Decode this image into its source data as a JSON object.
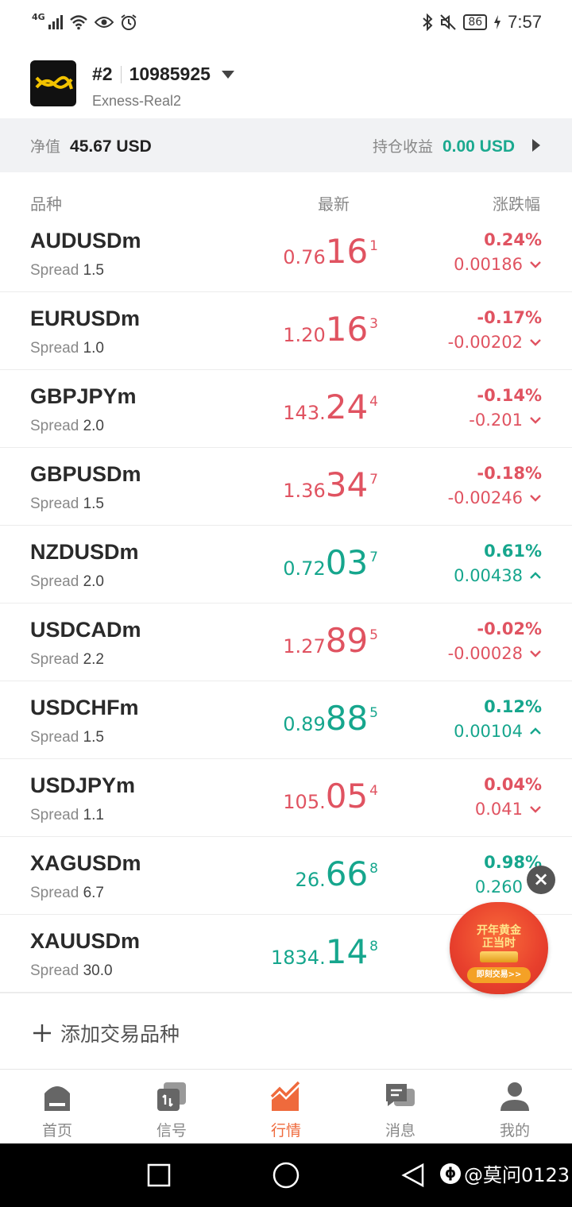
{
  "status_bar": {
    "network": "4G",
    "battery": "86",
    "time": "7:57"
  },
  "account": {
    "number_prefix": "#2",
    "account_id": "10985925",
    "server": "Exness-Real2"
  },
  "summary": {
    "equity_label": "净值",
    "equity_value": "45.67 USD",
    "pl_label": "持仓收益",
    "pl_value": "0.00 USD"
  },
  "columns": {
    "symbol": "品种",
    "latest": "最新",
    "change": "涨跌幅"
  },
  "quotes": [
    {
      "symbol": "AUDUSDm",
      "spread_label": "Spread",
      "spread": "1.5",
      "price_a": "0.76",
      "price_b": "16",
      "price_c": "1",
      "pct": "0.24%",
      "abs": "0.00186",
      "dir": "down",
      "color": "#e05361"
    },
    {
      "symbol": "EURUSDm",
      "spread_label": "Spread",
      "spread": "1.0",
      "price_a": "1.20",
      "price_b": "16",
      "price_c": "3",
      "pct": "-0.17%",
      "abs": "-0.00202",
      "dir": "down",
      "color": "#e05361"
    },
    {
      "symbol": "GBPJPYm",
      "spread_label": "Spread",
      "spread": "2.0",
      "price_a": "143.",
      "price_b": "24",
      "price_c": "4",
      "pct": "-0.14%",
      "abs": "-0.201",
      "dir": "down",
      "color": "#e05361"
    },
    {
      "symbol": "GBPUSDm",
      "spread_label": "Spread",
      "spread": "1.5",
      "price_a": "1.36",
      "price_b": "34",
      "price_c": "7",
      "pct": "-0.18%",
      "abs": "-0.00246",
      "dir": "down",
      "color": "#e05361"
    },
    {
      "symbol": "NZDUSDm",
      "spread_label": "Spread",
      "spread": "2.0",
      "price_a": "0.72",
      "price_b": "03",
      "price_c": "7",
      "pct": "0.61%",
      "abs": "0.00438",
      "dir": "up",
      "color": "#16a68d"
    },
    {
      "symbol": "USDCADm",
      "spread_label": "Spread",
      "spread": "2.2",
      "price_a": "1.27",
      "price_b": "89",
      "price_c": "5",
      "pct": "-0.02%",
      "abs": "-0.00028",
      "dir": "down",
      "color": "#e05361"
    },
    {
      "symbol": "USDCHFm",
      "spread_label": "Spread",
      "spread": "1.5",
      "price_a": "0.89",
      "price_b": "88",
      "price_c": "5",
      "pct": "0.12%",
      "abs": "0.00104",
      "dir": "up",
      "color": "#16a68d"
    },
    {
      "symbol": "USDJPYm",
      "spread_label": "Spread",
      "spread": "1.1",
      "price_a": "105.",
      "price_b": "05",
      "price_c": "4",
      "pct": "0.04%",
      "abs": "0.041",
      "dir": "down",
      "color": "#e05361"
    },
    {
      "symbol": "XAGUSDm",
      "spread_label": "Spread",
      "spread": "6.7",
      "price_a": "26.",
      "price_b": "66",
      "price_c": "8",
      "pct": "0.98%",
      "abs": "0.260",
      "dir": "up",
      "color": "#16a68d"
    },
    {
      "symbol": "XAUUSDm",
      "spread_label": "Spread",
      "spread": "30.0",
      "price_a": "1834.",
      "price_b": "14",
      "price_c": "8",
      "pct": "",
      "abs": "",
      "dir": "up",
      "color": "#16a68d"
    }
  ],
  "add_symbol": {
    "label": "添加交易品种"
  },
  "promo": {
    "title_line1": "开年黄金",
    "title_line2": "正当时",
    "button": "即刻交易>>"
  },
  "tabs": [
    {
      "label": "首页",
      "icon": "home-icon"
    },
    {
      "label": "信号",
      "icon": "signal-icon"
    },
    {
      "label": "行情",
      "icon": "market-chart-icon"
    },
    {
      "label": "消息",
      "icon": "message-icon"
    },
    {
      "label": "我的",
      "icon": "profile-icon"
    }
  ],
  "watermark": {
    "text": "@莫问0123"
  },
  "colors": {
    "up": "#16a68d",
    "down": "#e05361",
    "accent": "#ef6a3c"
  }
}
